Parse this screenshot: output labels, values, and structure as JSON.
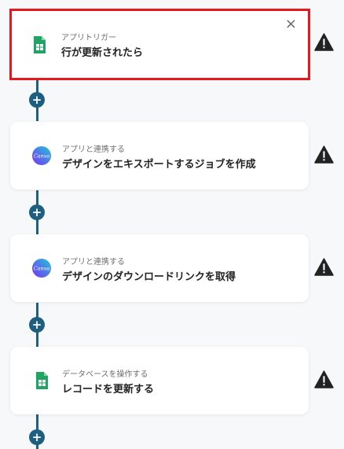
{
  "colors": {
    "accent": "#1e5f7f",
    "selected_border": "#e5181e",
    "sheets_green": "#1fa463",
    "warning": "#222222"
  },
  "steps": [
    {
      "label": "アプリトリガー",
      "title": "行が更新されたら",
      "icon": "google-sheets-icon",
      "selected": true
    },
    {
      "label": "アプリと連携する",
      "title": "デザインをエキスポートするジョブを作成",
      "icon": "canva-icon"
    },
    {
      "label": "アプリと連携する",
      "title": "デザインのダウンロードリンクを取得",
      "icon": "canva-icon"
    },
    {
      "label": "データベースを操作する",
      "title": "レコードを更新する",
      "icon": "google-sheets-icon"
    }
  ],
  "canva_text": "Canva",
  "close_symbol": "×",
  "plus_symbol": "+"
}
